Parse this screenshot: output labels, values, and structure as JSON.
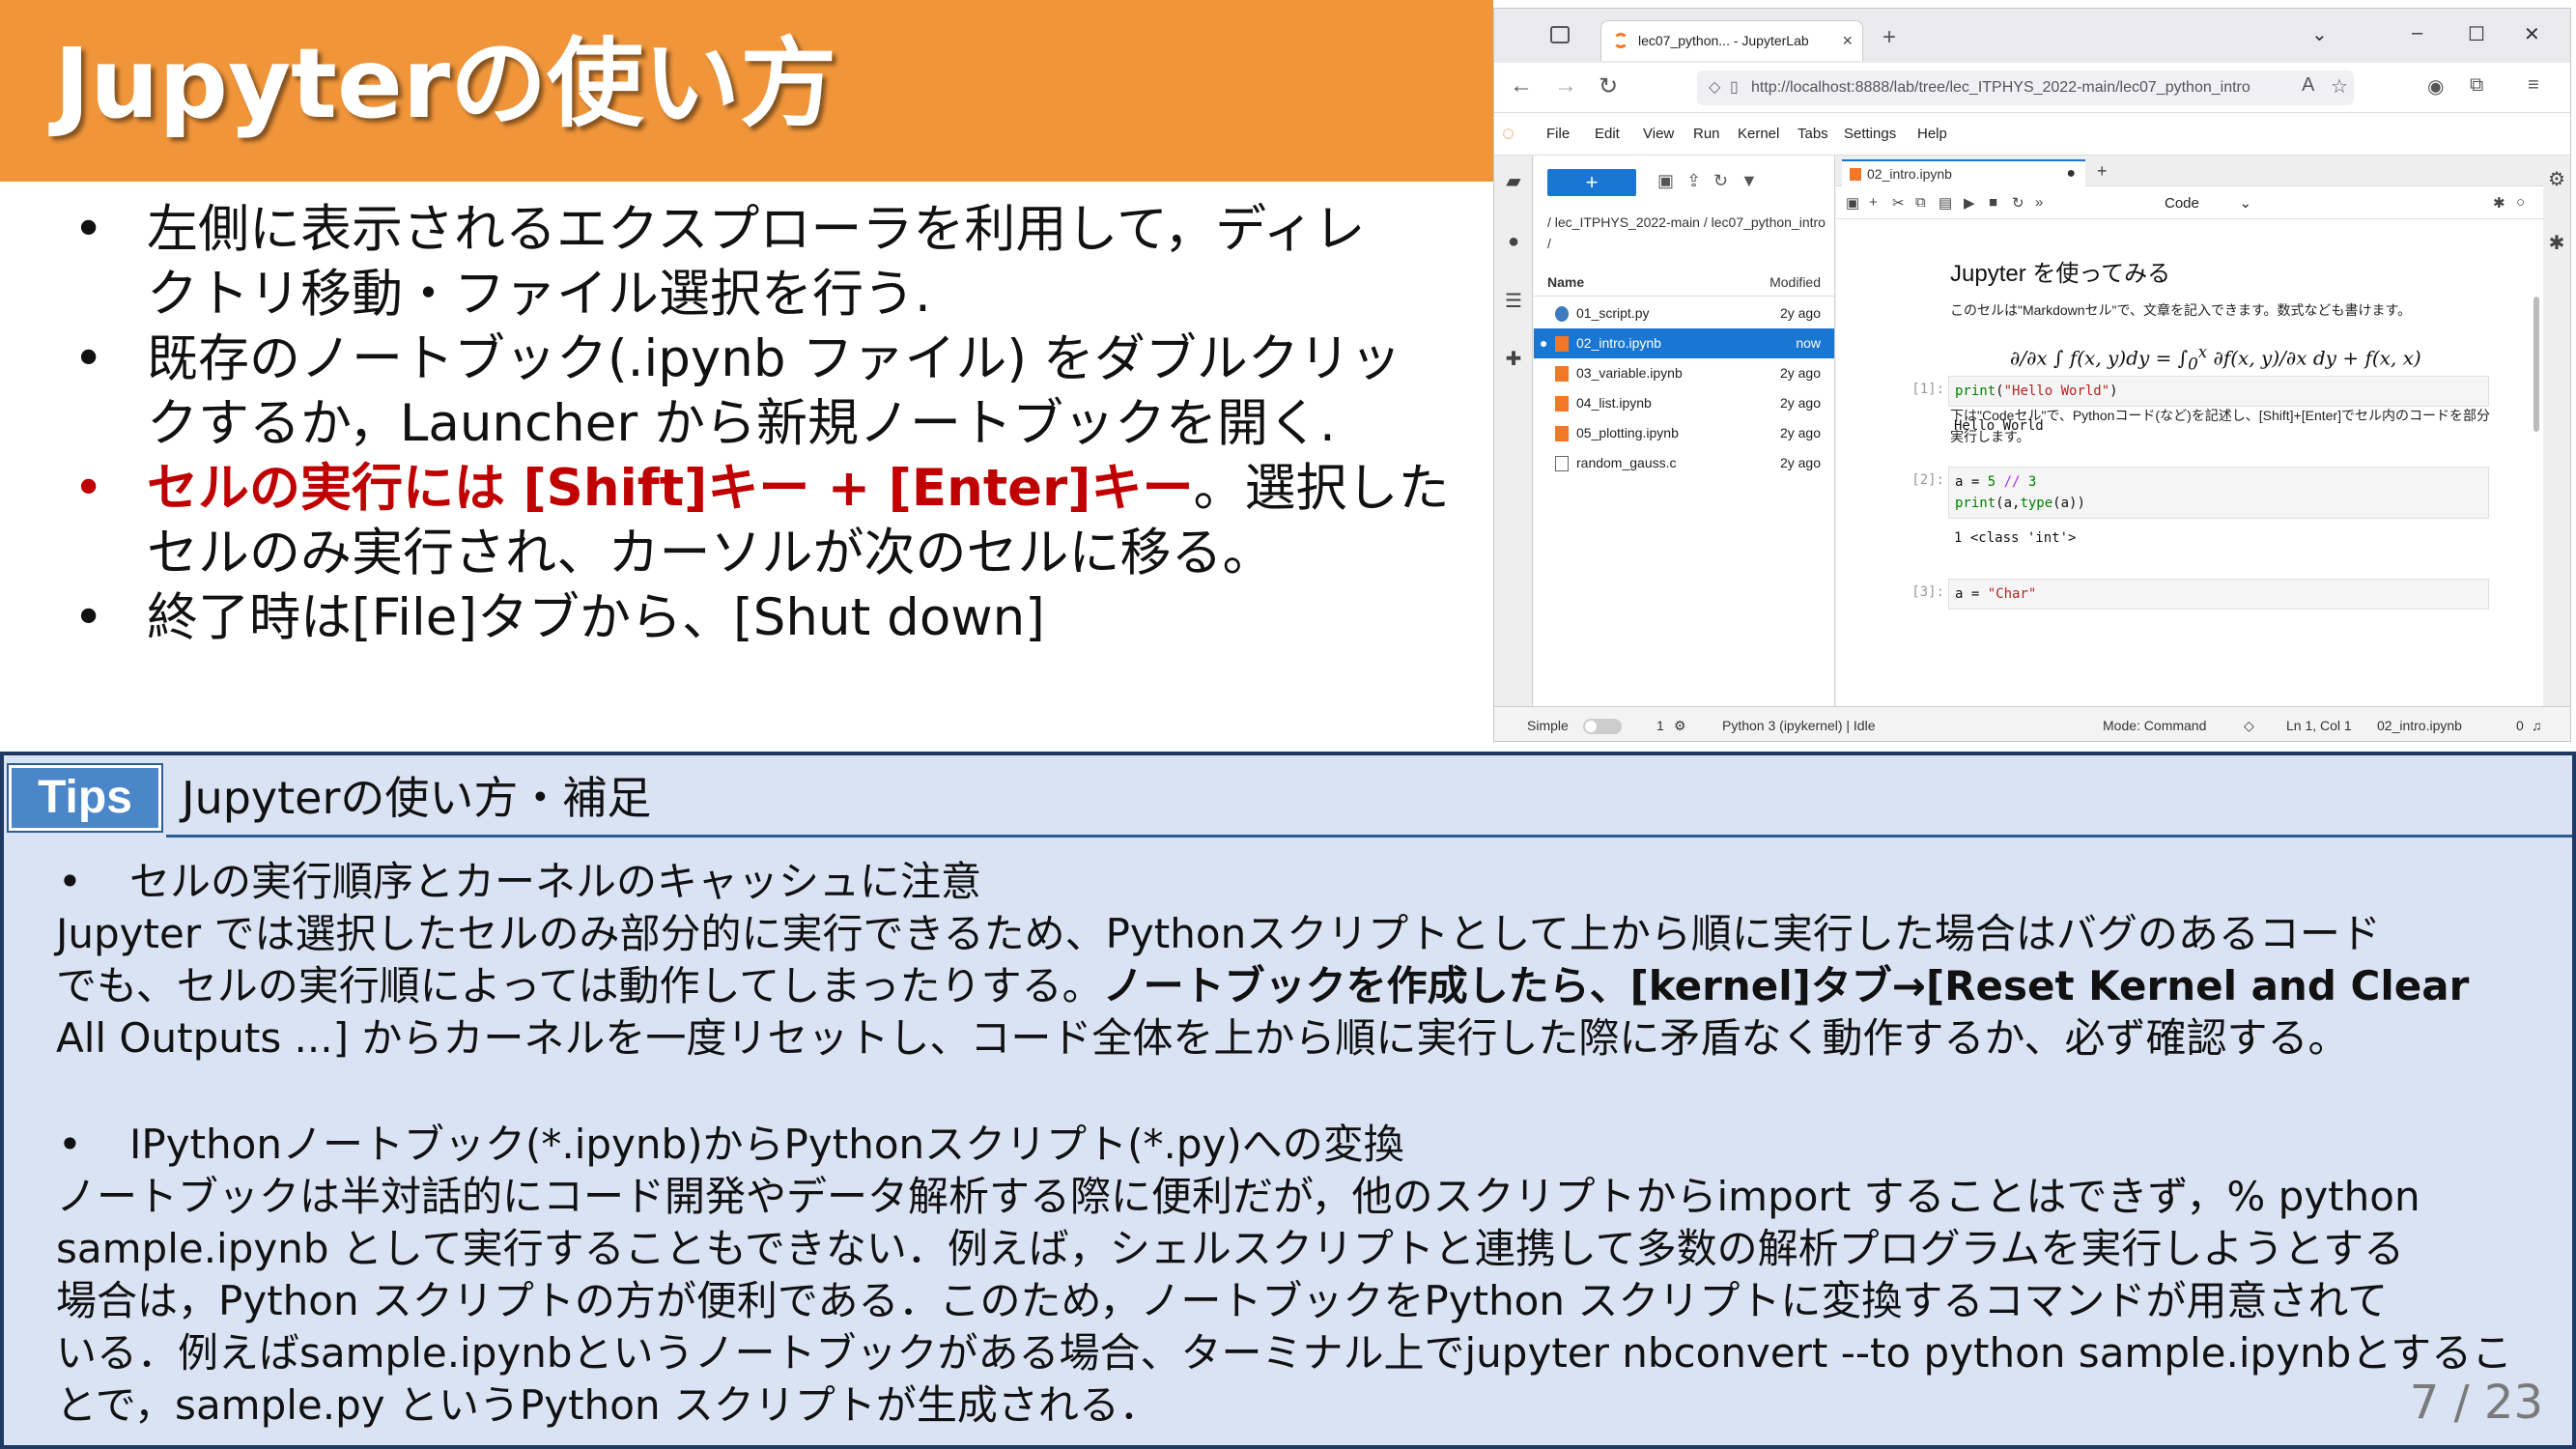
{
  "title": "Jupyterの使い方",
  "bullets": [
    {
      "line1": "左側に表示されるエクスプローラを利用して，ディレ",
      "line2": "クトリ移動・ファイル選択を行う."
    },
    {
      "line1": "既存のノートブック(.ipynb ファイル) をダブルクリッ",
      "line2": "クするか，Launcher から新規ノートブックを開く."
    },
    {
      "red": "セルの実行には [Shift]キー + [Enter]キー",
      "rest1": "。選択した",
      "line2": "セルのみ実行され、カーソルが次のセルに移る。"
    },
    {
      "line1": "終了時は[File]タブから、[Shut down]"
    }
  ],
  "screenshot": {
    "browser_tab_title": "lec07_python... - JupyterLab",
    "url": "http://localhost:8888/lab/tree/lec_ITPHYS_2022-main/lec07_python_intro",
    "menu": [
      "File",
      "Edit",
      "View",
      "Run",
      "Kernel",
      "Tabs",
      "Settings",
      "Help"
    ],
    "new_button": "+",
    "breadcrumb": "/ lec_ITPHYS_2022-main / lec07_python_intro /",
    "col_name": "Name",
    "col_modified": "Modified",
    "files": [
      {
        "name": "01_script.py",
        "modified": "2y ago"
      },
      {
        "name": "02_intro.ipynb",
        "modified": "now"
      },
      {
        "name": "03_variable.ipynb",
        "modified": "2y ago"
      },
      {
        "name": "04_list.ipynb",
        "modified": "2y ago"
      },
      {
        "name": "05_plotting.ipynb",
        "modified": "2y ago"
      },
      {
        "name": "random_gauss.c",
        "modified": "2y ago"
      }
    ],
    "doc_tab": "02_intro.ipynb",
    "cell_type": "Code",
    "md_heading": "Jupyter を使ってみる",
    "md_text": "このセルは\"Markdownセル\"で、文章を記入できます。数式なども書けます。",
    "md_text2": "下は\"Codeセル\"で、Pythonコード(など)を記述し、[Shift]+[Enter]でセル内のコードを部分実行します。",
    "cells": [
      {
        "prompt": "[1]:",
        "output": "Hello World"
      },
      {
        "prompt": "[2]:",
        "output": "1 <class 'int'>"
      },
      {
        "prompt": "[3]:"
      }
    ],
    "status": {
      "mode_toggle": "Simple",
      "count": "1",
      "kernel": "Python 3 (ipykernel) | Idle",
      "mode": "Mode: Command",
      "position": "Ln 1, Col 1",
      "file": "02_intro.ipynb",
      "bell": "0"
    }
  },
  "tips": {
    "badge": "Tips",
    "title": "Jupyterの使い方・補足",
    "s1_heading": "セルの実行順序とカーネルのキャッシュに注意",
    "s1_l1": "Jupyter では選択したセルのみ部分的に実行できるため、Pythonスクリプトとして上から順に実行した場合はバグのあるコード",
    "s1_l2a": "でも、セルの実行順によっては動作してしまったりする。",
    "s1_l2b": "ノートブックを作成したら、[kernel]タブ→[Reset Kernel and Clear",
    "s1_l3": "All Outputs ...] からカーネルを一度リセットし、コード全体を上から順に実行した際に矛盾なく動作するか、必ず確認する。",
    "s2_heading": "IPythonノートブック(*.ipynb)からPythonスクリプト(*.py)への変換",
    "s2_l1": "ノートブックは半対話的にコード開発やデータ解析する際に便利だが，他のスクリプトからimport することはできず，% python",
    "s2_l2": "sample.ipynb として実行することもできない．例えば，シェルスクリプトと連携して多数の解析プログラムを実行しようとする",
    "s2_l3": "場合は，Python スクリプトの方が便利である．このため，ノートブックをPython スクリプトに変換するコマンドが用意されて",
    "s2_l4": "いる．例えばsample.ipynbというノートブックがある場合、ターミナル上でjupyter nbconvert --to python sample.ipynbとするこ",
    "s2_l5": "とで，sample.py というPython スクリプトが生成される．"
  },
  "page_number": "7 / 23",
  "colors": {
    "banner": "#f0953a",
    "tips_bg": "#dae3f3",
    "accent_red": "#c00000",
    "jupyter_blue": "#1976d2"
  }
}
